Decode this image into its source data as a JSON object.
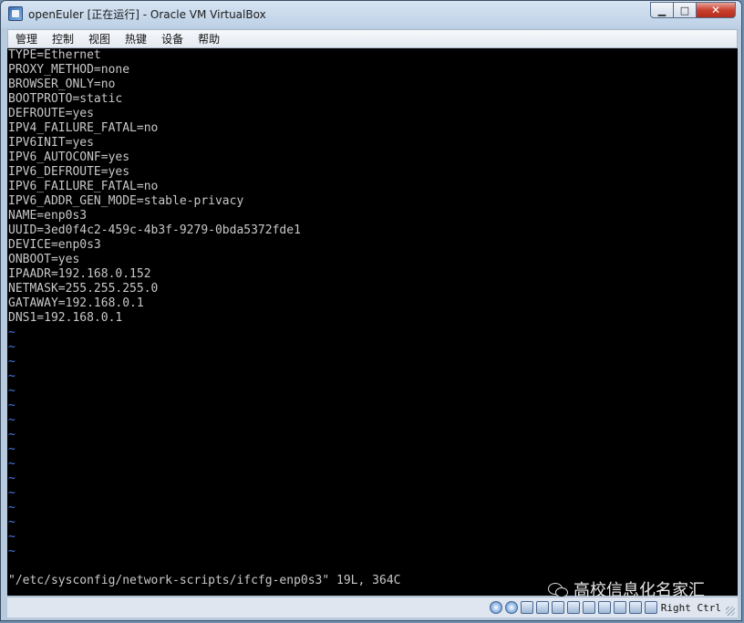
{
  "window": {
    "title": "openEuler [正在运行] - Oracle VM VirtualBox",
    "controls": {
      "minimize": "▁",
      "maximize": "□",
      "close": "✕"
    }
  },
  "menu": [
    "管理",
    "控制",
    "视图",
    "热键",
    "设备",
    "帮助"
  ],
  "terminal": {
    "lines": [
      "TYPE=Ethernet",
      "PROXY_METHOD=none",
      "BROWSER_ONLY=no",
      "BOOTPROTO=static",
      "DEFROUTE=yes",
      "IPV4_FAILURE_FATAL=no",
      "IPV6INIT=yes",
      "IPV6_AUTOCONF=yes",
      "IPV6_DEFROUTE=yes",
      "IPV6_FAILURE_FATAL=no",
      "IPV6_ADDR_GEN_MODE=stable-privacy",
      "NAME=enp0s3",
      "UUID=3ed0f4c2-459c-4b3f-9279-0bda5372fde1",
      "DEVICE=enp0s3",
      "ONBOOT=yes",
      "IPAADR=192.168.0.152",
      "NETMASK=255.255.255.0",
      "GATAWAY=192.168.0.1",
      "DNS1=192.168.0.1"
    ],
    "empty_marker": "~",
    "empty_line_count": 16,
    "status_line": "\"/etc/sysconfig/network-scripts/ifcfg-enp0s3\" 19L, 364C"
  },
  "watermark": {
    "text": "高校信息化名家汇"
  },
  "statusbar": {
    "tray_icons": [
      "hard-disk-icon",
      "optical-drive-icon",
      "audio-icon",
      "network-icon",
      "usb-icon",
      "shared-folders-icon",
      "display-icon",
      "video-capture-icon",
      "virtualization-icon",
      "mouse-integration-icon",
      "keyboard-icon"
    ],
    "host_key": "Right Ctrl"
  },
  "colors": {
    "terminal_bg": "#000000",
    "terminal_text": "#c8c8c8",
    "tilde": "#4a78e8",
    "titlebar": "#c9d9ea"
  }
}
